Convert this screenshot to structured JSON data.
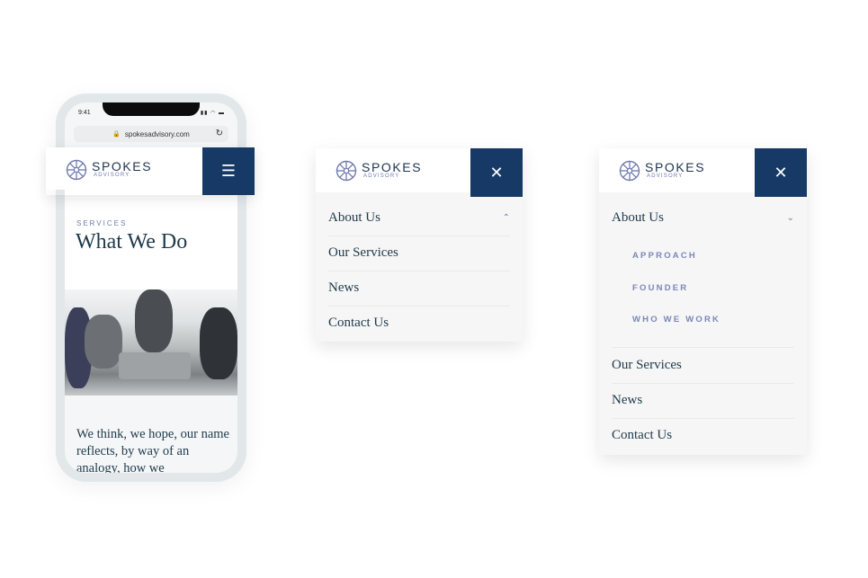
{
  "brand": {
    "name": "SPOKES",
    "sub": "ADVISORY",
    "colors": {
      "navy": "#163966",
      "accent": "#6f7aad",
      "text": "#1d3a4a"
    }
  },
  "phone": {
    "status_time": "9:41",
    "status_icons": "signal wifi battery",
    "url": "spokesadvisory.com",
    "menu_icon": "hamburger-icon",
    "eyebrow": "SERVICES",
    "title": "What We Do",
    "body": "We think, we hope, our name reflects, by way of an analogy, how we"
  },
  "menu_collapsed": {
    "close_icon": "close-icon",
    "items": [
      {
        "label": "About Us",
        "chevron": "up"
      },
      {
        "label": "Our Services"
      },
      {
        "label": "News"
      },
      {
        "label": "Contact Us"
      }
    ]
  },
  "menu_expanded": {
    "close_icon": "close-icon",
    "items": [
      {
        "label": "About Us",
        "chevron": "down"
      },
      {
        "label": "Our Services"
      },
      {
        "label": "News"
      },
      {
        "label": "Contact Us"
      }
    ],
    "sub_items": [
      "APPROACH",
      "FOUNDER",
      "WHO WE WORK"
    ]
  },
  "glyphs": {
    "hamburger": "☰",
    "close": "✕",
    "chevron_up": "︿",
    "chevron_down": "﹀",
    "lock": "🔒",
    "reload": "↻"
  }
}
